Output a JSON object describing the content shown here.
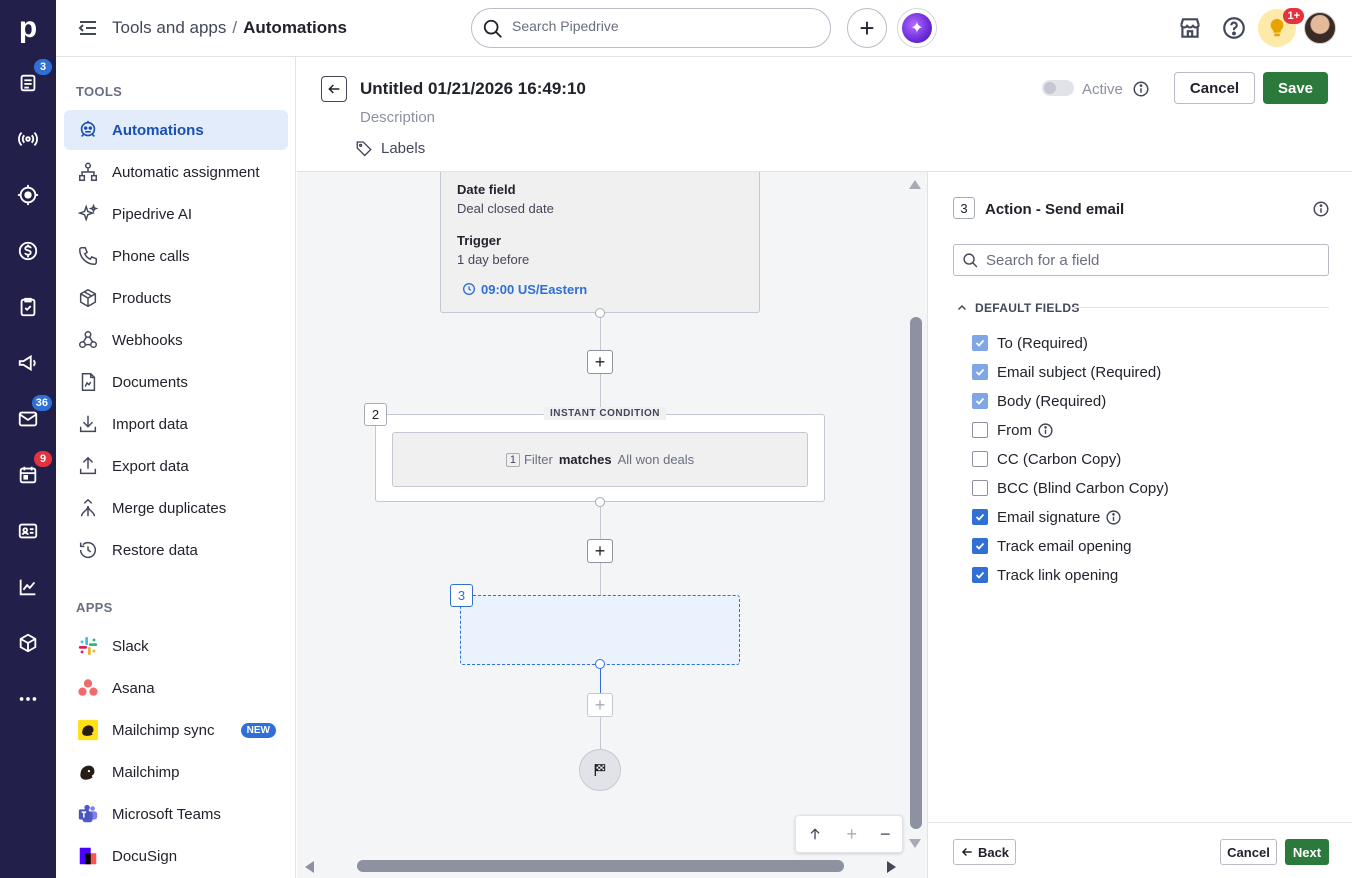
{
  "header": {
    "breadcrumb_parent": "Tools and apps",
    "breadcrumb_separator": "/",
    "breadcrumb_current": "Automations",
    "search_placeholder": "Search Pipedrive",
    "notification_badge": "1+"
  },
  "rail": {
    "logo": "p",
    "badges": {
      "leads": "3",
      "mail": "36",
      "activities": "9"
    }
  },
  "sidebar": {
    "tools_heading": "TOOLS",
    "tools": [
      {
        "label": "Automations",
        "icon": "robot-icon"
      },
      {
        "label": "Automatic assignment",
        "icon": "assignment-icon"
      },
      {
        "label": "Pipedrive AI",
        "icon": "sparkle-icon"
      },
      {
        "label": "Phone calls",
        "icon": "phone-icon"
      },
      {
        "label": "Products",
        "icon": "box-icon"
      },
      {
        "label": "Webhooks",
        "icon": "webhook-icon"
      },
      {
        "label": "Documents",
        "icon": "document-icon"
      },
      {
        "label": "Import data",
        "icon": "import-icon"
      },
      {
        "label": "Export data",
        "icon": "export-icon"
      },
      {
        "label": "Merge duplicates",
        "icon": "merge-icon"
      },
      {
        "label": "Restore data",
        "icon": "restore-icon"
      }
    ],
    "apps_heading": "APPS",
    "apps": [
      {
        "label": "Slack",
        "icon": "slack-icon"
      },
      {
        "label": "Asana",
        "icon": "asana-icon"
      },
      {
        "label": "Mailchimp sync",
        "icon": "mailchimp-icon",
        "badge": "NEW"
      },
      {
        "label": "Mailchimp",
        "icon": "mailchimp-icon"
      },
      {
        "label": "Microsoft Teams",
        "icon": "teams-icon"
      },
      {
        "label": "DocuSign",
        "icon": "docusign-icon"
      }
    ]
  },
  "editor": {
    "title": "Untitled 01/21/2026 16:49:10",
    "description_placeholder": "Description",
    "labels": "Labels",
    "active_label": "Active",
    "active": false,
    "cancel": "Cancel",
    "save": "Save"
  },
  "flow": {
    "trigger": {
      "date_field_label": "Date field",
      "date_field_value": "Deal closed date",
      "trigger_label": "Trigger",
      "trigger_value": "1 day before",
      "time": "09:00 US/Eastern"
    },
    "condition": {
      "step": "2",
      "title": "INSTANT CONDITION",
      "filter_num": "1",
      "filter_label": "Filter",
      "operator": "matches",
      "value": "All won deals"
    },
    "action_step": "3"
  },
  "panel": {
    "step": "3",
    "title": "Action - Send email",
    "search_placeholder": "Search for a field",
    "section": "DEFAULT FIELDS",
    "fields": [
      {
        "label": "To (Required)",
        "checked": true,
        "locked": true
      },
      {
        "label": "Email subject (Required)",
        "checked": true,
        "locked": true
      },
      {
        "label": "Body (Required)",
        "checked": true,
        "locked": true
      },
      {
        "label": "From",
        "checked": false,
        "info": true
      },
      {
        "label": "CC (Carbon Copy)",
        "checked": false
      },
      {
        "label": "BCC (Blind Carbon Copy)",
        "checked": false
      },
      {
        "label": "Email signature",
        "checked": true,
        "info": true
      },
      {
        "label": "Track email opening",
        "checked": true
      },
      {
        "label": "Track link opening",
        "checked": true
      }
    ],
    "back": "Back",
    "cancel": "Cancel",
    "next": "Next"
  },
  "colors": {
    "rail": "#221f4a",
    "accent_blue": "#2f6fd6",
    "save_green": "#2b7a3c",
    "active_item_bg": "#e3ecfa"
  }
}
